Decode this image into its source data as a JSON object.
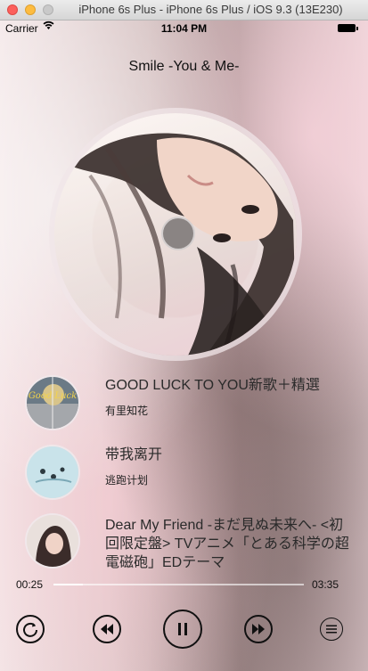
{
  "window": {
    "title": "iPhone 6s Plus - iPhone 6s Plus / iOS 9.3 (13E230)"
  },
  "status_bar": {
    "carrier": "Carrier",
    "time": "11:04 PM"
  },
  "player": {
    "now_playing_title": "Smile -You & Me-",
    "elapsed": "00:25",
    "duration": "03:35",
    "progress_fraction": 0.116
  },
  "playlist": [
    {
      "title": "GOOD LUCK TO YOU新歌＋精選",
      "artist": "有里知花",
      "thumb_text": "Good Luck"
    },
    {
      "title": "带我离开",
      "artist": "逃跑计划"
    },
    {
      "title": "Dear My Friend -まだ見ぬ未来へ- <初回限定盤> TVアニメ「とある科学の超電磁砲」EDテーマ",
      "artist": ""
    }
  ],
  "controls": {
    "icons": [
      "repeat-icon",
      "previous-icon",
      "pause-icon",
      "next-icon",
      "list-icon"
    ]
  }
}
